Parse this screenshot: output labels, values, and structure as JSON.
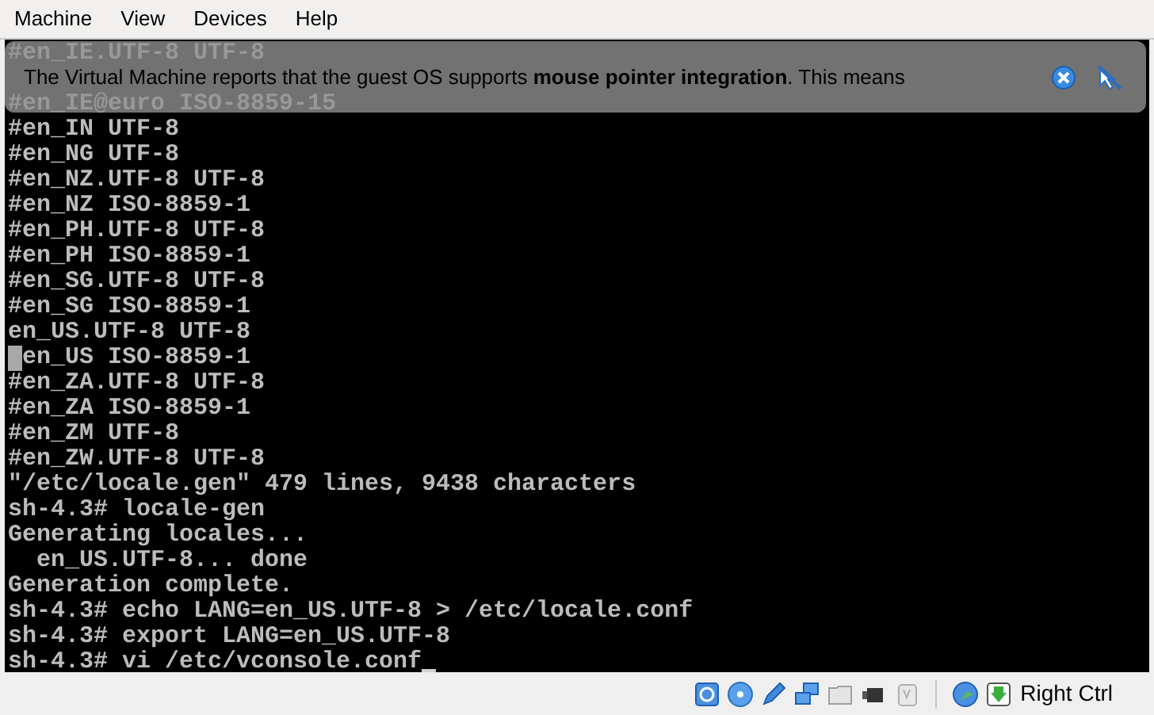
{
  "menu": [
    "Machine",
    "View",
    "Devices",
    "Help"
  ],
  "terminal": [
    {
      "text": "#en_IE.UTF-8 UTF-8",
      "kind": "plain"
    },
    {
      "kind": "hidden"
    },
    {
      "text": "#en_IE@euro ISO-8859-15",
      "kind": "plain"
    },
    {
      "text": "#en_IN UTF-8",
      "kind": "plain"
    },
    {
      "text": "#en_NG UTF-8",
      "kind": "plain"
    },
    {
      "text": "#en_NZ.UTF-8 UTF-8",
      "kind": "plain"
    },
    {
      "text": "#en_NZ ISO-8859-1",
      "kind": "plain"
    },
    {
      "text": "#en_PH.UTF-8 UTF-8",
      "kind": "plain"
    },
    {
      "text": "#en_PH ISO-8859-1",
      "kind": "plain"
    },
    {
      "text": "#en_SG.UTF-8 UTF-8",
      "kind": "plain"
    },
    {
      "text": "#en_SG ISO-8859-1",
      "kind": "plain"
    },
    {
      "text": "en_US.UTF-8 UTF-8",
      "kind": "plain"
    },
    {
      "text": "en_US ISO-8859-1",
      "kind": "block_cursor"
    },
    {
      "text": "#en_ZA.UTF-8 UTF-8",
      "kind": "plain"
    },
    {
      "text": "#en_ZA ISO-8859-1",
      "kind": "plain"
    },
    {
      "text": "#en_ZM UTF-8",
      "kind": "plain"
    },
    {
      "text": "#en_ZW.UTF-8 UTF-8",
      "kind": "plain"
    },
    {
      "text": "\"/etc/locale.gen\" 479 lines, 9438 characters",
      "kind": "plain"
    },
    {
      "text": "sh-4.3# locale-gen",
      "kind": "plain"
    },
    {
      "text": "Generating locales...",
      "kind": "plain"
    },
    {
      "text": "  en_US.UTF-8... done",
      "kind": "plain"
    },
    {
      "text": "Generation complete.",
      "kind": "plain"
    },
    {
      "text": "sh-4.3# echo LANG=en_US.UTF-8 > /etc/locale.conf",
      "kind": "plain"
    },
    {
      "text": "sh-4.3# export LANG=en_US.UTF-8",
      "kind": "plain"
    },
    {
      "text": "sh-4.3# vi /etc/vconsole.conf",
      "kind": "underline_cursor"
    }
  ],
  "notice": {
    "message": "The Virtual Machine reports that the guest OS supports **mouse pointer integration**. This means"
  },
  "status_bar": {
    "host_key": "Right Ctrl"
  }
}
